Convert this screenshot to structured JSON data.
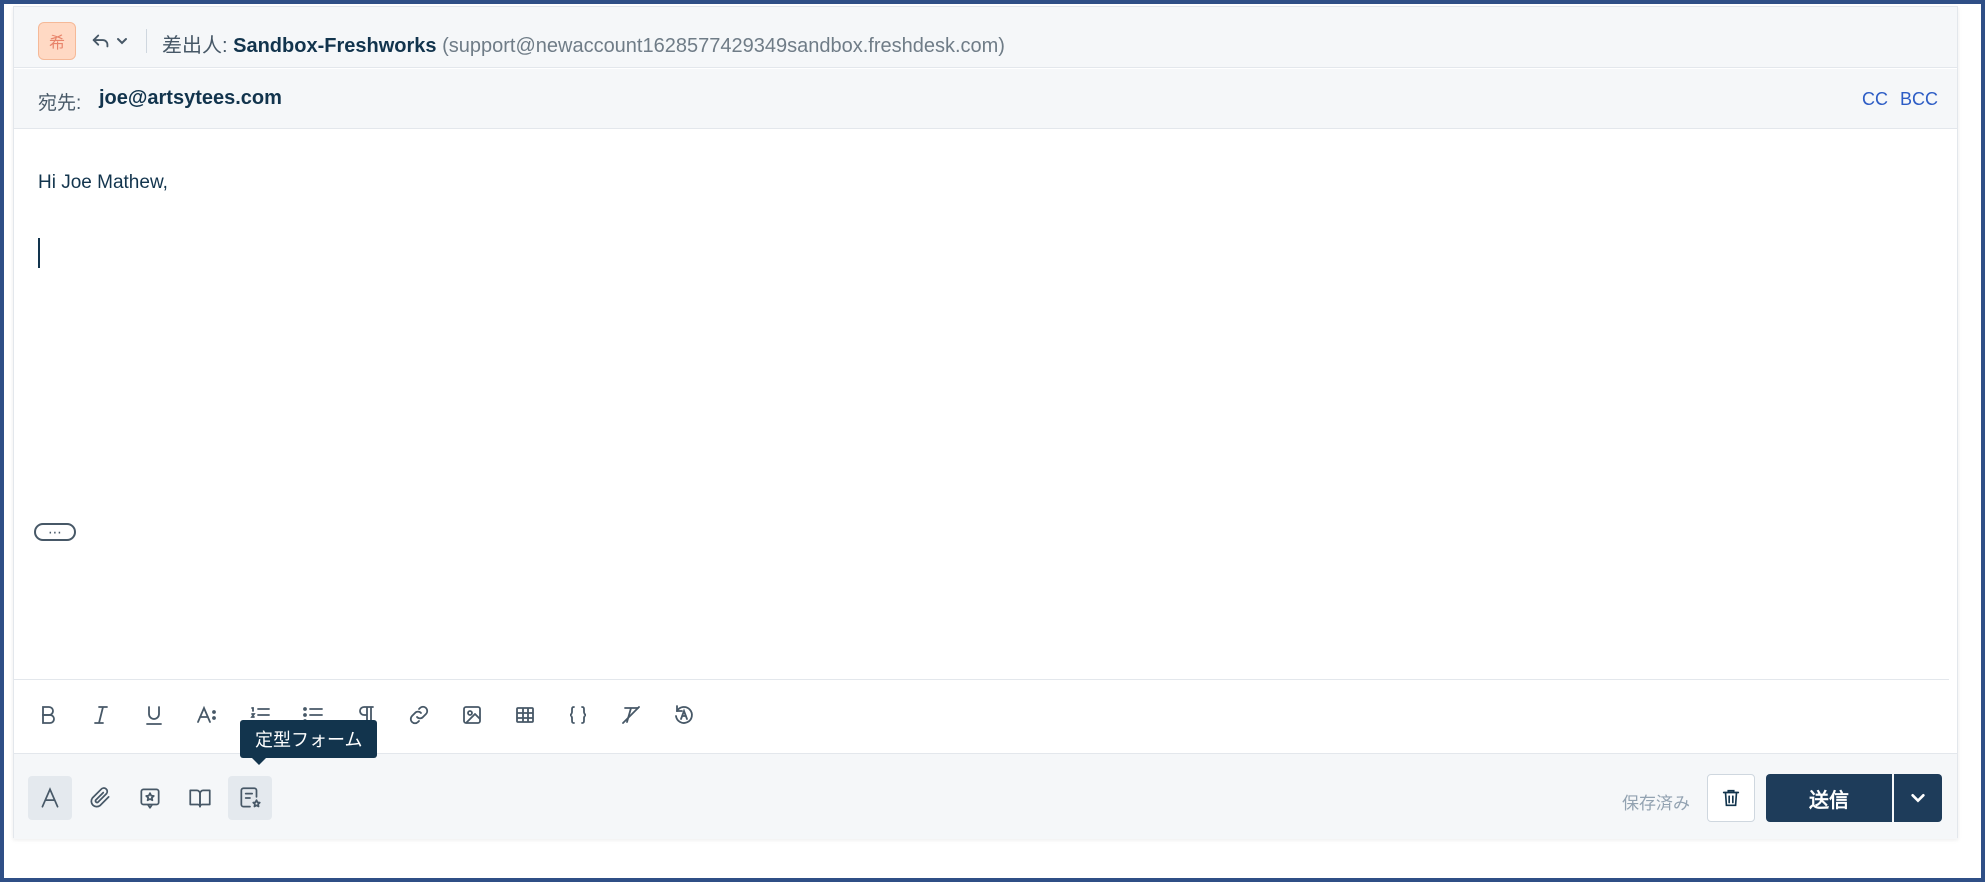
{
  "header": {
    "avatar_initial": "希",
    "from_label": "差出人:",
    "from_name": "Sandbox-Freshworks",
    "from_email": "(support@newaccount1628577429349sandbox.freshdesk.com)"
  },
  "recipients": {
    "to_label": "宛先:",
    "to_email": "joe@artsytees.com",
    "cc_label": "CC",
    "bcc_label": "BCC"
  },
  "editor": {
    "greeting": "Hi Joe Mathew,",
    "more_label": "⋯"
  },
  "format_toolbar": {
    "items": [
      "bold-icon",
      "italic-icon",
      "underline-icon",
      "font-size-icon",
      "ordered-list-icon",
      "unordered-list-icon",
      "paragraph-icon",
      "link-icon",
      "image-icon",
      "table-icon",
      "code-braces-icon",
      "clear-format-icon",
      "autocorrect-icon"
    ]
  },
  "action_bar": {
    "tooltip": "定型フォーム",
    "saved_label": "保存済み",
    "send_label": "送信"
  },
  "colors": {
    "accent": "#2c5cc5",
    "send_button": "#1e3c5a",
    "frame_border": "#2f4f86",
    "avatar_bg": "#ffd9c4"
  }
}
